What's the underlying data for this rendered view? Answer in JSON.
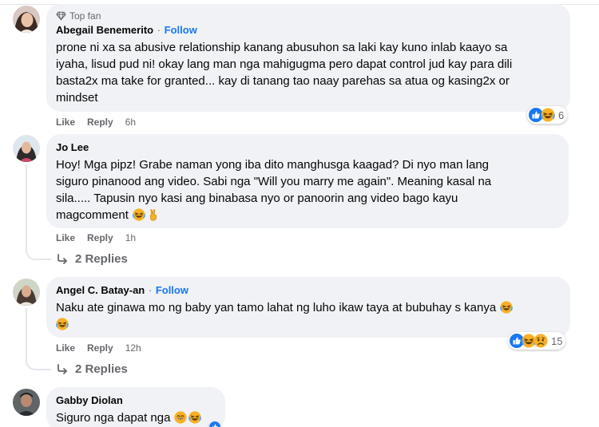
{
  "comments": [
    {
      "badge": "Top fan",
      "name": "Abegail Benemerito",
      "follow": "Follow",
      "lines": [
        "prone ni xa sa abusive relationship kanang abusuhon sa laki kay kuno inlab kaayo sa",
        "iyaha, lisud pud ni! okay lang man nga mahigugma pero dapat control jud kay para dili",
        "basta2x ma take for granted... kay di tanang tao naay parehas sa atua og kasing2x or",
        "mindset"
      ],
      "like": "Like",
      "reply": "Reply",
      "time": "6h",
      "reaction_count": "6"
    },
    {
      "name": "Jo Lee",
      "lines": [
        "Hoy! Mga pipz! Grabe naman yong iba dito manghusga kaagad? Di nyo man lang",
        "siguro pinanood ang video. Sabi nga \"Will you marry me again\". Meaning kasal na",
        "sila..... Tapusin nyo kasi ang binabasa nyo or panoorin ang video bago kayu",
        "magcomment"
      ],
      "like": "Like",
      "reply": "Reply",
      "time": "1h",
      "replies": "2 Replies"
    },
    {
      "name": "Angel C. Batay-an",
      "follow": "Follow",
      "lines": [
        "Naku ate ginawa mo ng baby yan tamo lahat ng luho ikaw taya at bubuhay s kanya"
      ],
      "like": "Like",
      "reply": "Reply",
      "time": "12h",
      "reaction_count": "15",
      "replies": "2 Replies"
    },
    {
      "name": "Gabby Diolan",
      "lines": [
        "Siguro nga dapat nga"
      ]
    }
  ],
  "colors": {
    "bubble": "#f0f2f5",
    "link_blue": "#1877f2",
    "meta_gray": "#65676b",
    "like_blue": "#1877f2",
    "emoji_yellow": "#f7b125"
  },
  "icons": {
    "top_fan": "diamond-badge-icon",
    "reply_arrow": "reply-arrow-icon",
    "reactions": [
      "like-reaction-icon",
      "haha-reaction-icon",
      "sad-reaction-icon"
    ],
    "inline_emoji": [
      "laughing-emoji-icon",
      "victory-hand-emoji-icon",
      "smile-emoji-icon"
    ]
  }
}
